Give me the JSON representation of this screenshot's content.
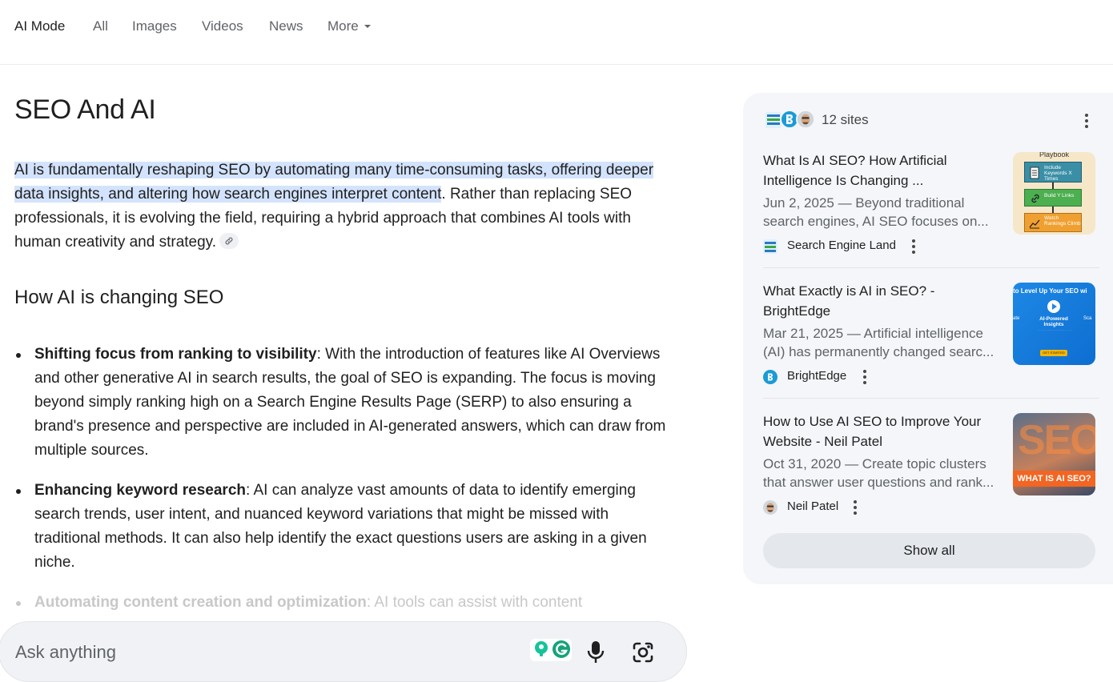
{
  "nav": {
    "tabs": [
      {
        "label": "AI Mode",
        "active": true
      },
      {
        "label": "All"
      },
      {
        "label": "Images"
      },
      {
        "label": "Videos"
      },
      {
        "label": "News"
      },
      {
        "label": "More"
      }
    ]
  },
  "main": {
    "title": "SEO And AI",
    "intro_highlight": "AI is fundamentally reshaping SEO by automating many time-consuming tasks, offering deeper data insights, and altering how search engines interpret content",
    "intro_rest": ". Rather than replacing SEO professionals, it is evolving the field, requiring a hybrid approach that combines AI tools with human creativity and strategy.",
    "section_title": "How AI is changing SEO",
    "bullets": [
      {
        "heading": "Shifting focus from ranking to visibility",
        "text": ": With the introduction of features like AI Overviews and other generative AI in search results, the goal of SEO is expanding. The focus is moving beyond simply ranking high on a Search Engine Results Page (SERP) to also ensuring a brand's presence and perspective are included in AI-generated answers, which can draw from multiple sources."
      },
      {
        "heading": "Enhancing keyword research",
        "text": ": AI can analyze vast amounts of data to identify emerging search trends, user intent, and nuanced keyword variations that might be missed with traditional methods. It can also help identify the exact questions users are asking in a given niche."
      },
      {
        "heading": "Automating content creation and optimization",
        "text": ": AI tools can assist with content"
      }
    ]
  },
  "ask": {
    "placeholder": "Ask anything",
    "icons": [
      "grammarly-extension-icon",
      "microphone-icon",
      "google-lens-icon"
    ]
  },
  "sources": {
    "count_label": "12 sites",
    "cards": [
      {
        "title": "What Is AI SEO? How Artificial Intelligence Is Changing ...",
        "snippet": "Jun 2, 2025 — Beyond traditional search engines, AI SEO focuses on...",
        "site": "Search Engine Land",
        "thumb": {
          "heading": "Playbook",
          "steps": [
            "Include Keywords X Times",
            "Build Y Links",
            "Watch Rankings Climb"
          ]
        }
      },
      {
        "title": "What Exactly is AI in SEO? - BrightEdge",
        "snippet": "Mar 21, 2025 — Artificial intelligence (AI) has permanently changed searc...",
        "site": "BrightEdge",
        "thumb": {
          "heading": "to Level Up Your SEO wi",
          "center": "AI-Powered Insights",
          "left": "ate",
          "right": "Sca",
          "button": "GET STARTED"
        }
      },
      {
        "title": "How to Use AI SEO to Improve Your Website - Neil Patel",
        "snippet": "Oct 31, 2020 — Create topic clusters that answer user questions and rank...",
        "site": "Neil Patel",
        "thumb": {
          "big": "SEO",
          "caption": "WHAT IS AI SEO?"
        }
      }
    ],
    "show_all": "Show all"
  },
  "colors": {
    "highlight": "#d3e3fd",
    "panel_bg": "#f4f6f9",
    "brightedge_blue": "#1a9bd7",
    "playbook_teal": "#3a8fa6",
    "playbook_green": "#4caf50",
    "playbook_orange": "#f0a030",
    "neil_orange": "#f26522"
  }
}
